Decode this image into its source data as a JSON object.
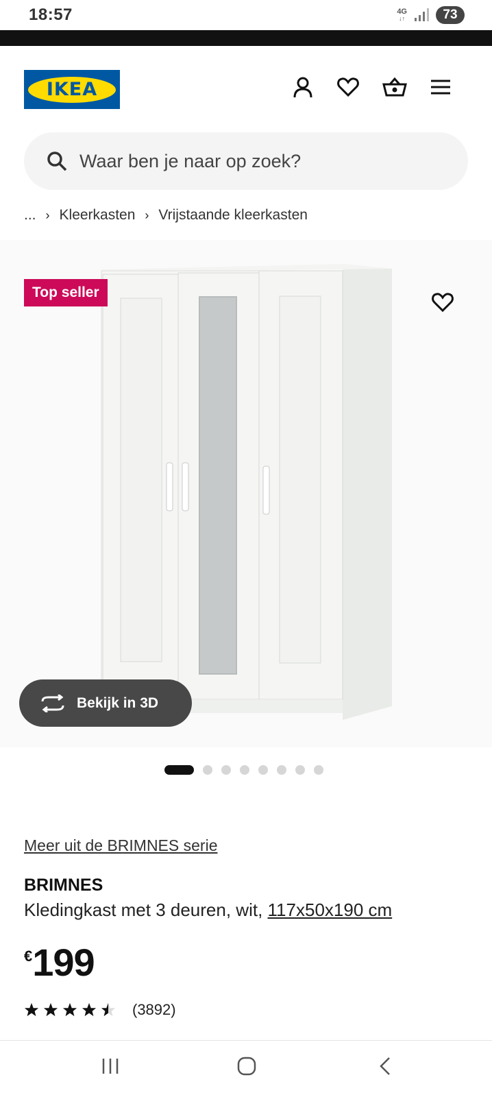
{
  "status": {
    "time": "18:57",
    "network": "4G",
    "battery": "73"
  },
  "header": {
    "logo_text": "IKEA",
    "brand_blue": "#0058a3",
    "brand_yellow": "#ffdb00"
  },
  "search": {
    "placeholder": "Waar ben je naar op zoek?"
  },
  "breadcrumb": {
    "ellipsis": "...",
    "items": [
      "Kleerkasten",
      "Vrijstaande kleerkasten"
    ]
  },
  "product": {
    "badge": "Top seller",
    "badge_color": "#cc0a59",
    "view3d_label": "Bekijk in 3D",
    "carousel": {
      "total": 8,
      "active": 1
    },
    "series_link": "Meer uit de BRIMNES serie",
    "name": "BRIMNES",
    "description": "Kledingkast met 3 deuren, wit,",
    "dimensions": "117x50x190 cm",
    "price_currency": "€",
    "price": "199",
    "rating": 4.5,
    "review_count": "(3892)"
  },
  "icons": [
    "profile-icon",
    "heart-icon",
    "basket-icon",
    "menu-icon",
    "search-icon",
    "rotate-3d-icon",
    "star-icon"
  ]
}
